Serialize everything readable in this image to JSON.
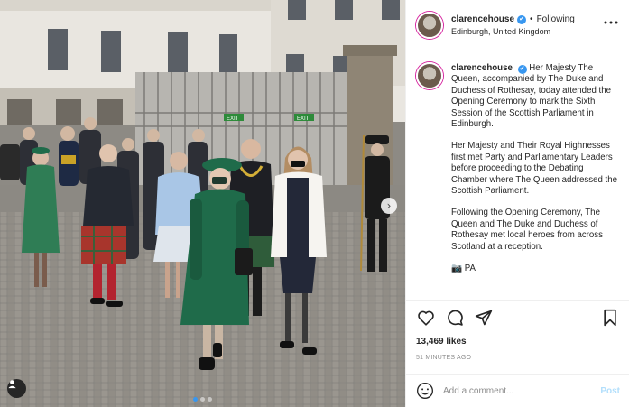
{
  "post": {
    "username": "clarencehouse",
    "verified_glyph": "✔",
    "separator": "•",
    "follow_state": "Following",
    "location": "Edinburgh, United Kingdom",
    "caption_paragraphs": [
      "Her Majesty The Queen, accompanied by The Duke and Duchess of Rothesay, today attended the Opening Ceremony to mark the Sixth Session of the Scottish Parliament in Edinburgh.",
      "Her Majesty and Their Royal Highnesses first met Party and Parliamentary Leaders before proceeding to the Debating Chamber where The Queen addressed the Scottish Parliament.",
      "Following the Opening Ceremony, The Queen and The Duke and Duchess of Rothesay met local heroes from across Scotland at a reception.",
      "📷 PA"
    ],
    "likes": "13,469 likes",
    "time_ago": "51 MINUTES AGO",
    "comment_placeholder": "Add a comment...",
    "post_label": "Post",
    "carousel": {
      "total": 3,
      "active": 1
    },
    "photo_signage": "EXIT"
  },
  "icons": {
    "more": "more-horizontal-icon",
    "like": "heart-icon",
    "comment": "comment-icon",
    "share": "share-icon",
    "save": "bookmark-icon",
    "emoji": "emoji-icon",
    "tag": "user-tag-icon",
    "next": "chevron-right-icon"
  },
  "colors": {
    "accent": "#3897f0",
    "post_disabled": "#b2dffc",
    "text": "#262626",
    "muted": "#8e8e8e",
    "queen_coat": "#1f6b4a",
    "kilt": "#a8352c"
  }
}
